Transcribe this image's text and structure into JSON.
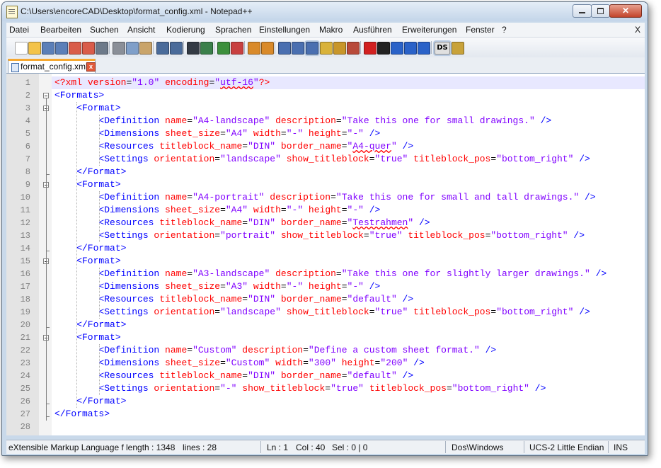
{
  "window": {
    "title": "C:\\Users\\encoreCAD\\Desktop\\format_config.xml - Notepad++"
  },
  "menu": [
    "Datei",
    "Bearbeiten",
    "Suchen",
    "Ansicht",
    "Kodierung",
    "Sprachen",
    "Einstellungen",
    "Makro",
    "Ausführen",
    "Erweiterungen",
    "Fenster",
    "?"
  ],
  "menu_close": "X",
  "toolbar": {
    "icons": [
      "new-file-icon",
      "open-file-icon",
      "save-icon",
      "save-all-icon",
      "close-icon",
      "close-all-icon",
      "print-icon",
      "cut-icon",
      "copy-icon",
      "paste-icon",
      "undo-icon",
      "redo-icon",
      "find-icon",
      "replace-icon",
      "zoom-in-icon",
      "zoom-out-icon",
      "sync-vertical-icon",
      "sync-horizontal-icon",
      "word-wrap-icon",
      "show-all-chars-icon",
      "indent-guide-icon",
      "language-icon",
      "document-map-icon",
      "function-list-icon",
      "record-macro-icon",
      "stop-macro-icon",
      "play-macro-icon",
      "run-macro-multiple-icon",
      "save-macro-icon",
      "ds-plugin-icon",
      "spell-check-icon"
    ],
    "ds_label": "DS"
  },
  "tab": {
    "label": "format_config.xml",
    "close": "x"
  },
  "code_lines": [
    [
      [
        "t-pi",
        "<?xml"
      ],
      [
        "t-attr",
        " version"
      ],
      [
        "t-eq",
        "="
      ],
      [
        "t-val",
        "\"1.0\""
      ],
      [
        "t-attr",
        " encoding"
      ],
      [
        "t-eq",
        "="
      ],
      [
        "t-val",
        "\"utf-16\""
      ],
      [
        "t-pi",
        "?>"
      ]
    ],
    [
      [
        "t-tag",
        "<Formats>"
      ]
    ],
    [
      [
        "t-tag",
        "    <Format>"
      ]
    ],
    [
      [
        "t-tag",
        "        <Definition"
      ],
      [
        "t-attr",
        " name"
      ],
      [
        "t-eq",
        "="
      ],
      [
        "t-val",
        "\"A4-landscape\""
      ],
      [
        "t-attr",
        " description"
      ],
      [
        "t-eq",
        "="
      ],
      [
        "t-val",
        "\"Take this one for small drawings.\""
      ],
      [
        "t-sym",
        " />"
      ]
    ],
    [
      [
        "t-tag",
        "        <Dimensions"
      ],
      [
        "t-attr",
        " sheet_size"
      ],
      [
        "t-eq",
        "="
      ],
      [
        "t-val",
        "\"A4\""
      ],
      [
        "t-attr",
        " width"
      ],
      [
        "t-eq",
        "="
      ],
      [
        "t-val",
        "\"-\""
      ],
      [
        "t-attr",
        " height"
      ],
      [
        "t-eq",
        "="
      ],
      [
        "t-val",
        "\"-\""
      ],
      [
        "t-sym",
        " />"
      ]
    ],
    [
      [
        "t-tag",
        "        <Resources"
      ],
      [
        "t-attr",
        " titleblock_name"
      ],
      [
        "t-eq",
        "="
      ],
      [
        "t-val",
        "\"DIN\""
      ],
      [
        "t-attr",
        " border_name"
      ],
      [
        "t-eq",
        "="
      ],
      [
        "t-val",
        "\"A4-quer\""
      ],
      [
        "t-sym",
        " />"
      ]
    ],
    [
      [
        "t-tag",
        "        <Settings"
      ],
      [
        "t-attr",
        " orientation"
      ],
      [
        "t-eq",
        "="
      ],
      [
        "t-val",
        "\"landscape\""
      ],
      [
        "t-attr",
        " show_titleblock"
      ],
      [
        "t-eq",
        "="
      ],
      [
        "t-val",
        "\"true\""
      ],
      [
        "t-attr",
        " titleblock_pos"
      ],
      [
        "t-eq",
        "="
      ],
      [
        "t-val",
        "\"bottom_right\""
      ],
      [
        "t-sym",
        " />"
      ]
    ],
    [
      [
        "t-tag",
        "    </Format>"
      ]
    ],
    [
      [
        "t-tag",
        "    <Format>"
      ]
    ],
    [
      [
        "t-tag",
        "        <Definition"
      ],
      [
        "t-attr",
        " name"
      ],
      [
        "t-eq",
        "="
      ],
      [
        "t-val",
        "\"A4-portrait\""
      ],
      [
        "t-attr",
        " description"
      ],
      [
        "t-eq",
        "="
      ],
      [
        "t-val",
        "\"Take this one for small and tall drawings.\""
      ],
      [
        "t-sym",
        " />"
      ]
    ],
    [
      [
        "t-tag",
        "        <Dimensions"
      ],
      [
        "t-attr",
        " sheet_size"
      ],
      [
        "t-eq",
        "="
      ],
      [
        "t-val",
        "\"A4\""
      ],
      [
        "t-attr",
        " width"
      ],
      [
        "t-eq",
        "="
      ],
      [
        "t-val",
        "\"-\""
      ],
      [
        "t-attr",
        " height"
      ],
      [
        "t-eq",
        "="
      ],
      [
        "t-val",
        "\"-\""
      ],
      [
        "t-sym",
        " />"
      ]
    ],
    [
      [
        "t-tag",
        "        <Resources"
      ],
      [
        "t-attr",
        " titleblock_name"
      ],
      [
        "t-eq",
        "="
      ],
      [
        "t-val",
        "\"DIN\""
      ],
      [
        "t-attr",
        " border_name"
      ],
      [
        "t-eq",
        "="
      ],
      [
        "t-val",
        "\"Testrahmen\""
      ],
      [
        "t-sym",
        " />"
      ]
    ],
    [
      [
        "t-tag",
        "        <Settings"
      ],
      [
        "t-attr",
        " orientation"
      ],
      [
        "t-eq",
        "="
      ],
      [
        "t-val",
        "\"portrait\""
      ],
      [
        "t-attr",
        " show_titleblock"
      ],
      [
        "t-eq",
        "="
      ],
      [
        "t-val",
        "\"true\""
      ],
      [
        "t-attr",
        " titleblock_pos"
      ],
      [
        "t-eq",
        "="
      ],
      [
        "t-val",
        "\"bottom_right\""
      ],
      [
        "t-sym",
        " />"
      ]
    ],
    [
      [
        "t-tag",
        "    </Format>"
      ]
    ],
    [
      [
        "t-tag",
        "    <Format>"
      ]
    ],
    [
      [
        "t-tag",
        "        <Definition"
      ],
      [
        "t-attr",
        " name"
      ],
      [
        "t-eq",
        "="
      ],
      [
        "t-val",
        "\"A3-landscape\""
      ],
      [
        "t-attr",
        " description"
      ],
      [
        "t-eq",
        "="
      ],
      [
        "t-val",
        "\"Take this one for slightly larger drawings.\""
      ],
      [
        "t-sym",
        " />"
      ]
    ],
    [
      [
        "t-tag",
        "        <Dimensions"
      ],
      [
        "t-attr",
        " sheet_size"
      ],
      [
        "t-eq",
        "="
      ],
      [
        "t-val",
        "\"A3\""
      ],
      [
        "t-attr",
        " width"
      ],
      [
        "t-eq",
        "="
      ],
      [
        "t-val",
        "\"-\""
      ],
      [
        "t-attr",
        " height"
      ],
      [
        "t-eq",
        "="
      ],
      [
        "t-val",
        "\"-\""
      ],
      [
        "t-sym",
        " />"
      ]
    ],
    [
      [
        "t-tag",
        "        <Resources"
      ],
      [
        "t-attr",
        " titleblock_name"
      ],
      [
        "t-eq",
        "="
      ],
      [
        "t-val",
        "\"DIN\""
      ],
      [
        "t-attr",
        " border_name"
      ],
      [
        "t-eq",
        "="
      ],
      [
        "t-val",
        "\"default\""
      ],
      [
        "t-sym",
        " />"
      ]
    ],
    [
      [
        "t-tag",
        "        <Settings"
      ],
      [
        "t-attr",
        " orientation"
      ],
      [
        "t-eq",
        "="
      ],
      [
        "t-val",
        "\"landscape\""
      ],
      [
        "t-attr",
        " show_titleblock"
      ],
      [
        "t-eq",
        "="
      ],
      [
        "t-val",
        "\"true\""
      ],
      [
        "t-attr",
        " titleblock_pos"
      ],
      [
        "t-eq",
        "="
      ],
      [
        "t-val",
        "\"bottom_right\""
      ],
      [
        "t-sym",
        " />"
      ]
    ],
    [
      [
        "t-tag",
        "    </Format>"
      ]
    ],
    [
      [
        "t-tag",
        "    <Format>"
      ]
    ],
    [
      [
        "t-tag",
        "        <Definition"
      ],
      [
        "t-attr",
        " name"
      ],
      [
        "t-eq",
        "="
      ],
      [
        "t-val",
        "\"Custom\""
      ],
      [
        "t-attr",
        " description"
      ],
      [
        "t-eq",
        "="
      ],
      [
        "t-val",
        "\"Define a custom sheet format.\""
      ],
      [
        "t-sym",
        " />"
      ]
    ],
    [
      [
        "t-tag",
        "        <Dimensions"
      ],
      [
        "t-attr",
        " sheet_size"
      ],
      [
        "t-eq",
        "="
      ],
      [
        "t-val",
        "\"Custom\""
      ],
      [
        "t-attr",
        " width"
      ],
      [
        "t-eq",
        "="
      ],
      [
        "t-val",
        "\"300\""
      ],
      [
        "t-attr",
        " height"
      ],
      [
        "t-eq",
        "="
      ],
      [
        "t-val",
        "\"200\""
      ],
      [
        "t-sym",
        " />"
      ]
    ],
    [
      [
        "t-tag",
        "        <Resources"
      ],
      [
        "t-attr",
        " titleblock_name"
      ],
      [
        "t-eq",
        "="
      ],
      [
        "t-val",
        "\"DIN\""
      ],
      [
        "t-attr",
        " border_name"
      ],
      [
        "t-eq",
        "="
      ],
      [
        "t-val",
        "\"default\""
      ],
      [
        "t-sym",
        " />"
      ]
    ],
    [
      [
        "t-tag",
        "        <Settings"
      ],
      [
        "t-attr",
        " orientation"
      ],
      [
        "t-eq",
        "="
      ],
      [
        "t-val",
        "\"-\""
      ],
      [
        "t-attr",
        " show_titleblock"
      ],
      [
        "t-eq",
        "="
      ],
      [
        "t-val",
        "\"true\""
      ],
      [
        "t-attr",
        " titleblock_pos"
      ],
      [
        "t-eq",
        "="
      ],
      [
        "t-val",
        "\"bottom_right\""
      ],
      [
        "t-sym",
        " />"
      ]
    ],
    [
      [
        "t-tag",
        "    </Format>"
      ]
    ],
    [
      [
        "t-tag",
        "</Formats>"
      ]
    ],
    []
  ],
  "misspelled": [
    "utf-16",
    "A4-quer",
    "Testrahmen"
  ],
  "status": {
    "language": "eXtensible Markup Language f",
    "length": "length : 1348",
    "lines": "lines : 28",
    "ln": "Ln : 1",
    "col": "Col : 40",
    "sel": "Sel : 0 | 0",
    "eol": "Dos\\Windows",
    "encoding": "UCS-2 Little Endian",
    "mode": "INS"
  }
}
